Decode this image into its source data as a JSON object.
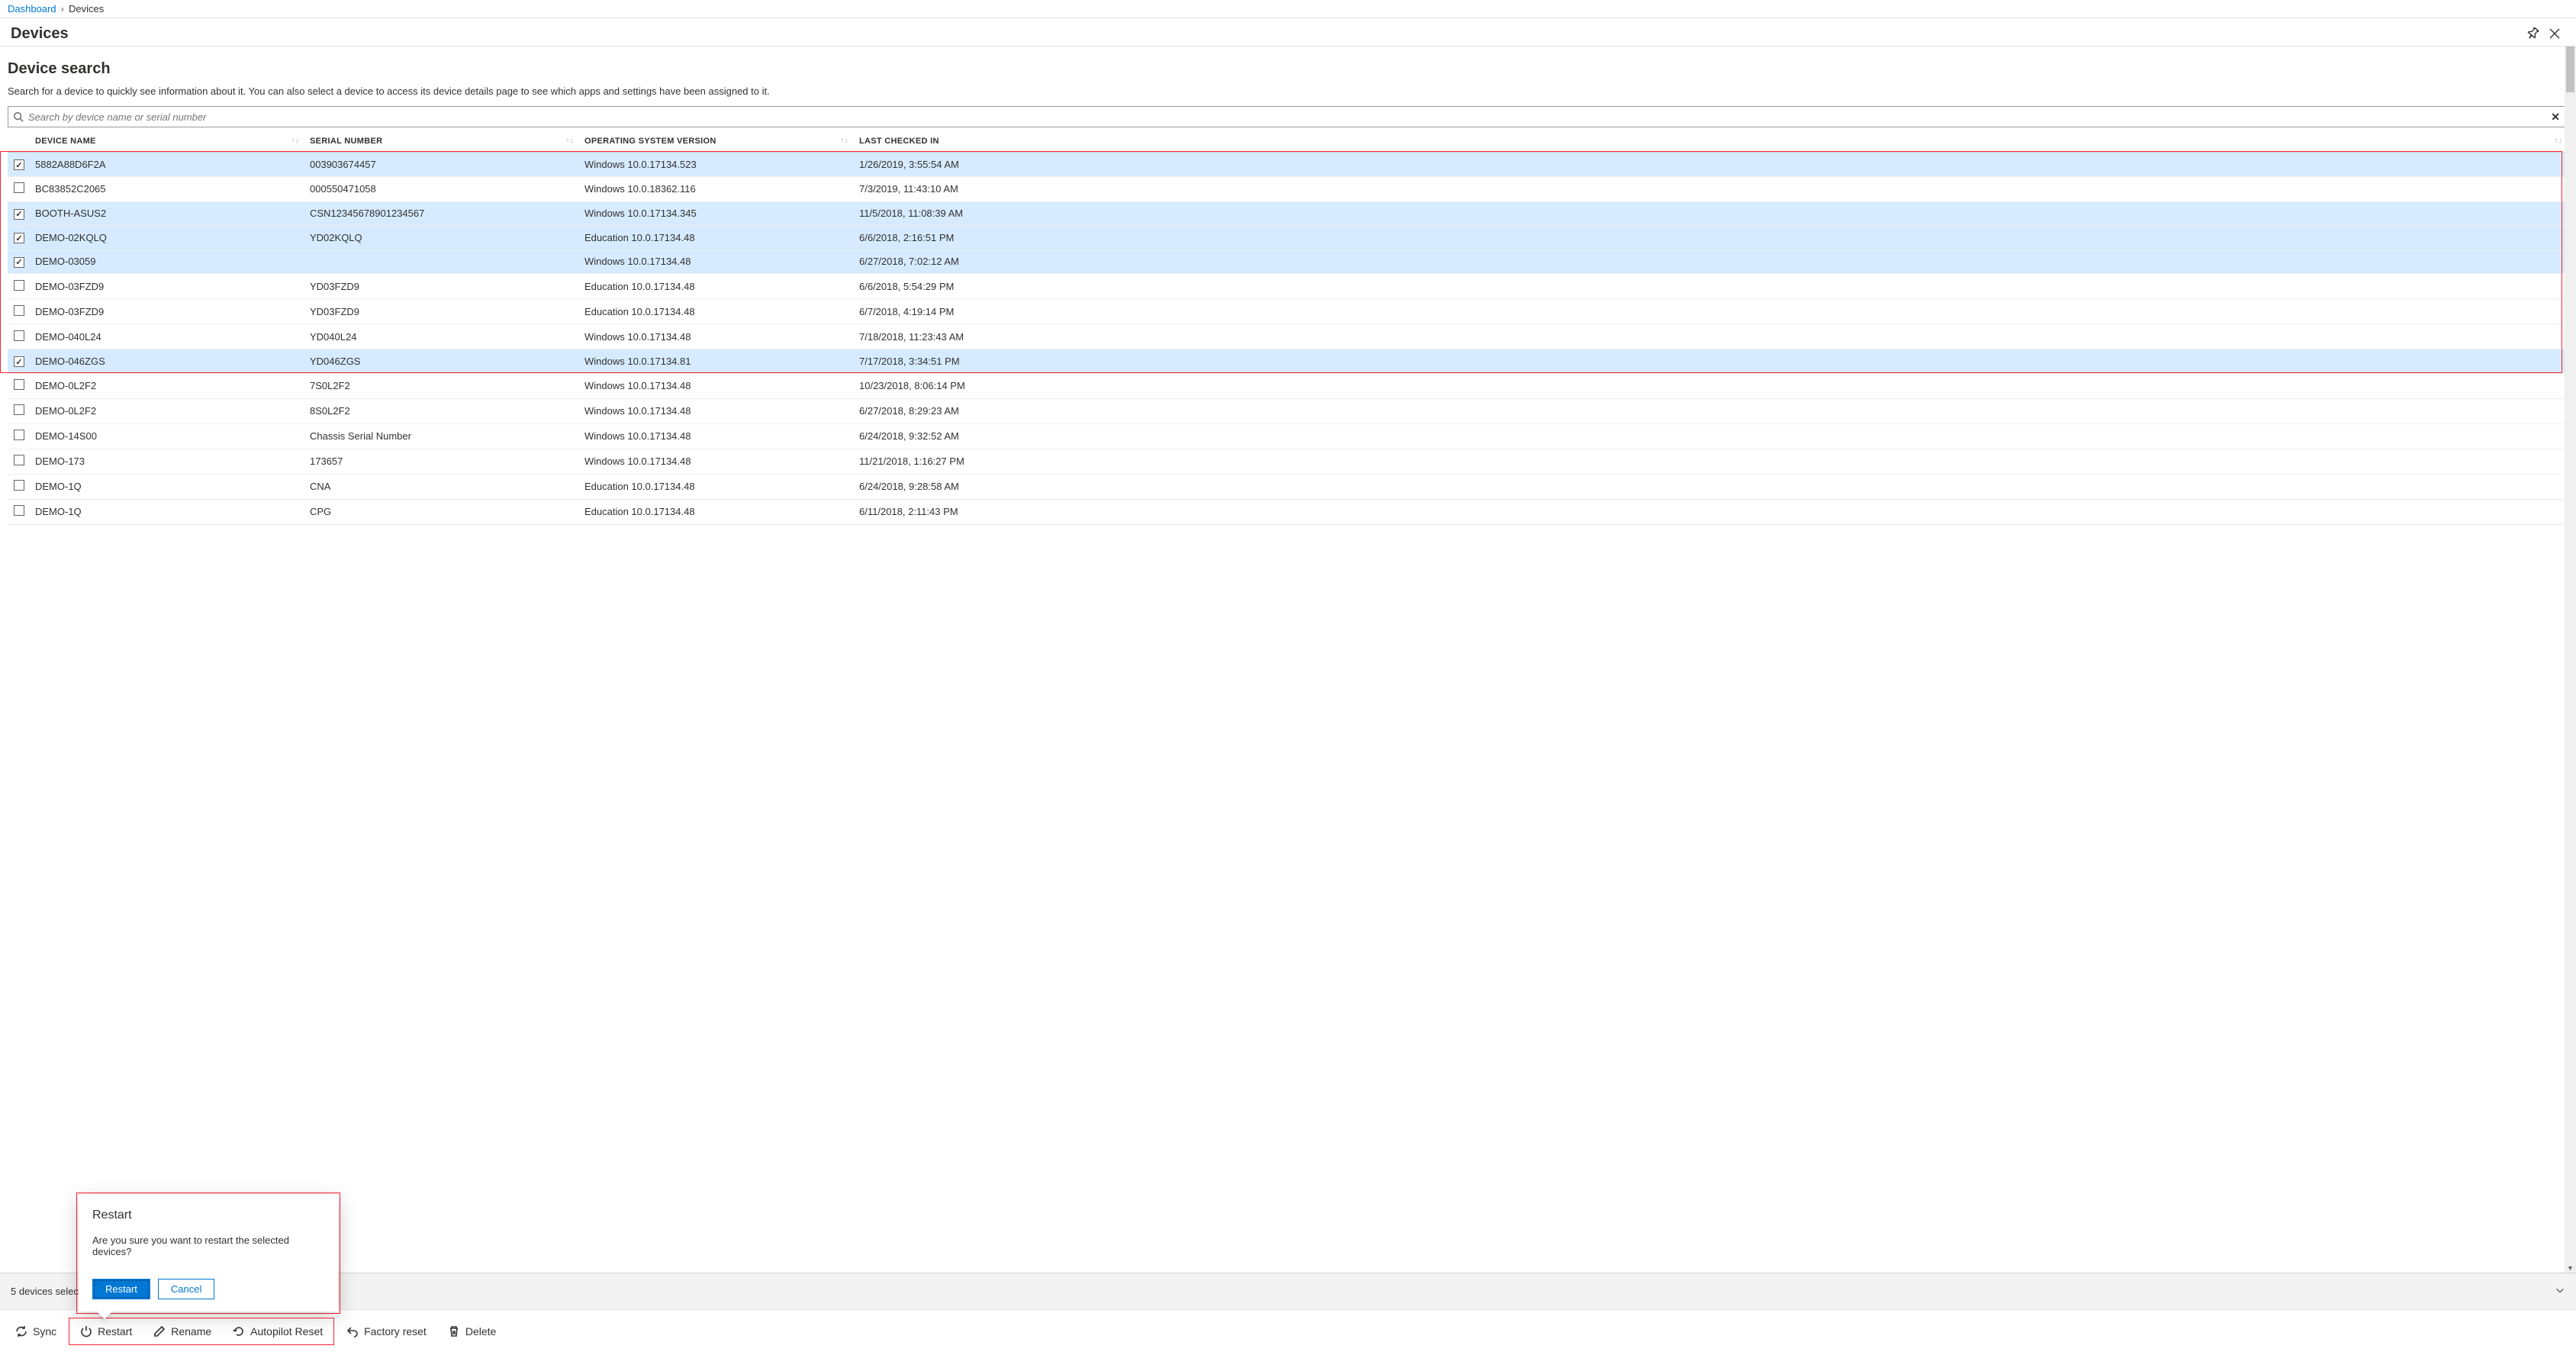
{
  "breadcrumb": {
    "root": "Dashboard",
    "current": "Devices"
  },
  "page": {
    "title": "Devices"
  },
  "search_section": {
    "heading": "Device search",
    "description": "Search for a device to quickly see information about it. You can also select a device to access its device details page to see which apps and settings have been assigned to it.",
    "placeholder": "Search by device name or serial number"
  },
  "columns": {
    "device_name": "DEVICE NAME",
    "serial_number": "SERIAL NUMBER",
    "os_version": "OPERATING SYSTEM VERSION",
    "last_checked": "LAST CHECKED IN"
  },
  "rows": [
    {
      "selected": true,
      "name": "5882A88D6F2A",
      "serial": "003903674457",
      "os": "Windows 10.0.17134.523",
      "checked": "1/26/2019, 3:55:54 AM"
    },
    {
      "selected": false,
      "name": "BC83852C2065",
      "serial": "000550471058",
      "os": "Windows 10.0.18362.116",
      "checked": "7/3/2019, 11:43:10 AM"
    },
    {
      "selected": true,
      "name": "BOOTH-ASUS2",
      "serial": "CSN12345678901234567",
      "os": "Windows 10.0.17134.345",
      "checked": "11/5/2018, 11:08:39 AM"
    },
    {
      "selected": true,
      "name": "DEMO-02KQLQ",
      "serial": "YD02KQLQ",
      "os": "Education 10.0.17134.48",
      "checked": "6/6/2018, 2:16:51 PM"
    },
    {
      "selected": true,
      "name": "DEMO-03059",
      "serial": "",
      "os": "Windows 10.0.17134.48",
      "checked": "6/27/2018, 7:02:12 AM"
    },
    {
      "selected": false,
      "name": "DEMO-03FZD9",
      "serial": "YD03FZD9",
      "os": "Education 10.0.17134.48",
      "checked": "6/6/2018, 5:54:29 PM"
    },
    {
      "selected": false,
      "name": "DEMO-03FZD9",
      "serial": "YD03FZD9",
      "os": "Education 10.0.17134.48",
      "checked": "6/7/2018, 4:19:14 PM"
    },
    {
      "selected": false,
      "name": "DEMO-040L24",
      "serial": "YD040L24",
      "os": "Windows 10.0.17134.48",
      "checked": "7/18/2018, 11:23:43 AM"
    },
    {
      "selected": true,
      "name": "DEMO-046ZGS",
      "serial": "YD046ZGS",
      "os": "Windows 10.0.17134.81",
      "checked": "7/17/2018, 3:34:51 PM"
    },
    {
      "selected": false,
      "name": "DEMO-0L2F2",
      "serial": "7S0L2F2",
      "os": "Windows 10.0.17134.48",
      "checked": "10/23/2018, 8:06:14 PM"
    },
    {
      "selected": false,
      "name": "DEMO-0L2F2",
      "serial": "8S0L2F2",
      "os": "Windows 10.0.17134.48",
      "checked": "6/27/2018, 8:29:23 AM"
    },
    {
      "selected": false,
      "name": "DEMO-14S00",
      "serial": "Chassis Serial Number",
      "os": "Windows 10.0.17134.48",
      "checked": "6/24/2018, 9:32:52 AM"
    },
    {
      "selected": false,
      "name": "DEMO-173",
      "serial": "173657",
      "os": "Windows 10.0.17134.48",
      "checked": "11/21/2018, 1:16:27 PM"
    },
    {
      "selected": false,
      "name": "DEMO-1Q",
      "serial": "CNA",
      "os": "Education 10.0.17134.48",
      "checked": "6/24/2018, 9:28:58 AM"
    },
    {
      "selected": false,
      "name": "DEMO-1Q",
      "serial": "CPG",
      "os": "Education 10.0.17134.48",
      "checked": "6/11/2018, 2:11:43 PM"
    }
  ],
  "selection_footer": {
    "text": "5 devices selected"
  },
  "commands": {
    "sync": "Sync",
    "restart": "Restart",
    "rename": "Rename",
    "autopilot": "Autopilot Reset",
    "factory": "Factory reset",
    "delete": "Delete"
  },
  "dialog": {
    "title": "Restart",
    "body": "Are you sure you want to restart the selected devices?",
    "confirm": "Restart",
    "cancel": "Cancel"
  }
}
